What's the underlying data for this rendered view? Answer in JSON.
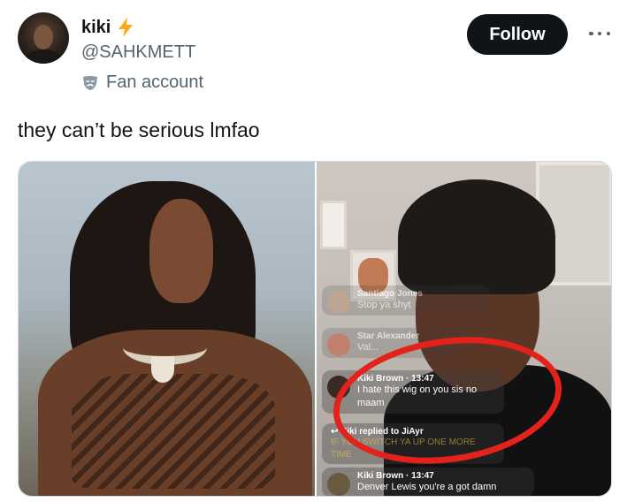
{
  "post": {
    "author": {
      "display_name": "kiki",
      "handle": "@SAHKMETT",
      "label": "Fan account",
      "badge_icon": "lightning-bolt-icon",
      "label_icon": "theater-mask-icon"
    },
    "follow_label": "Follow",
    "more_icon": "more-options-icon",
    "text": "they can’t be serious lmfao"
  },
  "media": {
    "chat": [
      {
        "user": "Santiago Jones",
        "time": "",
        "text": "Stop ya shyt",
        "faded": true
      },
      {
        "user": "Star Alexander",
        "time": "",
        "text": "Val...",
        "faded": true
      },
      {
        "user": "Kiki Brown",
        "time": "13:47",
        "text": "I hate this wig on you sis no maam",
        "faded": false
      },
      {
        "reply": "Kiki replied to JiAyr",
        "text": "IF YOU SWITCH YA UP ONE MORE TIME",
        "faded": true
      },
      {
        "user": "Kiki Brown",
        "time": "13:47",
        "text": "Denver Lewis you're a got damn",
        "faded": false
      }
    ]
  },
  "colors": {
    "follow_bg": "#0f1419",
    "secondary_text": "#536471",
    "bolt": "#f7a81b",
    "annotation_ring": "#e3221b"
  }
}
